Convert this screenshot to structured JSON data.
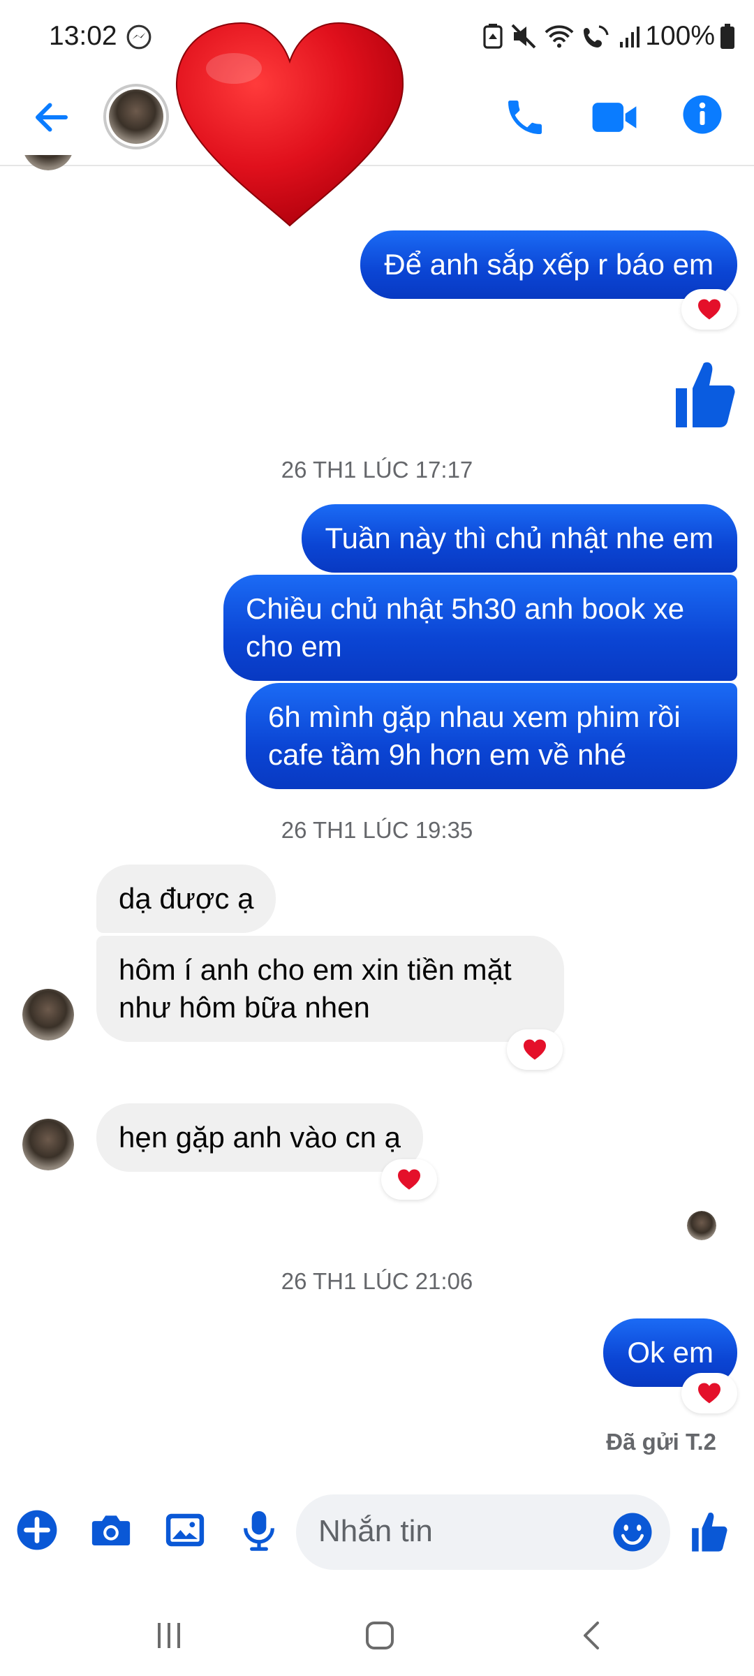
{
  "status_bar": {
    "time": "13:02",
    "battery": "100%"
  },
  "header": {
    "icons": [
      "back-arrow-icon",
      "phone-icon",
      "video-camera-icon",
      "info-icon"
    ],
    "accent_color": "#0a7cff"
  },
  "messages": [
    {
      "id": "m1",
      "side": "out",
      "text": "Để anh sắp xếp r báo em",
      "reaction": "heart"
    },
    {
      "id": "m2",
      "side": "out",
      "type": "thumbs-up-sticker"
    },
    {
      "id": "ts1",
      "type": "timestamp",
      "text": "26 TH1 LÚC 17:17"
    },
    {
      "id": "m3",
      "side": "out",
      "text": "Tuần này thì chủ nhật nhe em"
    },
    {
      "id": "m4",
      "side": "out",
      "text_lines": [
        "Chiều chủ nhật 5h30 anh book xe",
        "cho em"
      ]
    },
    {
      "id": "m5",
      "side": "out",
      "text_lines": [
        "6h mình gặp nhau xem phim rồi",
        "cafe tầm 9h hơn em về nhé"
      ]
    },
    {
      "id": "ts2",
      "type": "timestamp",
      "text": "26 TH1 LÚC 19:35"
    },
    {
      "id": "m6",
      "side": "in",
      "text": "dạ được ạ"
    },
    {
      "id": "m7",
      "side": "in",
      "text_lines": [
        "hôm í anh cho em xin tiền mặt",
        "như hôm bữa nhen"
      ],
      "reaction": "heart"
    },
    {
      "id": "m8",
      "side": "in",
      "text": "hẹn gặp anh vào cn ạ",
      "reaction": "heart"
    },
    {
      "id": "ts3",
      "type": "timestamp",
      "text": "26 TH1 LÚC 21:06"
    },
    {
      "id": "m9",
      "side": "out",
      "text": "Ok em",
      "reaction": "heart"
    }
  ],
  "m1": {
    "text": "Để anh sắp xếp r báo em"
  },
  "ts1": {
    "text": "26 TH1 LÚC 17:17"
  },
  "m3": {
    "text": "Tuần này thì chủ nhật nhe em"
  },
  "m4": {
    "line1": "Chiều chủ nhật 5h30 anh book xe",
    "line2": "cho em"
  },
  "m5": {
    "line1": "6h mình gặp nhau xem phim rồi",
    "line2": "cafe tầm 9h hơn em về nhé"
  },
  "ts2": {
    "text": "26 TH1 LÚC 19:35"
  },
  "m6": {
    "text": "dạ được ạ"
  },
  "m7": {
    "line1": "hôm í anh cho em xin tiền mặt",
    "line2": "như hôm bữa nhen"
  },
  "m8": {
    "text": "hẹn gặp anh vào cn ạ"
  },
  "ts3": {
    "text": "26 TH1 LÚC 21:06"
  },
  "m9": {
    "text": "Ok em"
  },
  "sent_status": "Đã gửi T.2",
  "composer": {
    "placeholder": "Nhắn tin",
    "icons": [
      "plus-icon",
      "camera-icon",
      "image-icon",
      "microphone-icon",
      "emoji-icon",
      "thumbs-up-icon"
    ]
  },
  "colors": {
    "outgoing_bubble": "#0b45d4",
    "incoming_bubble": "#f0f0f0",
    "accent": "#0a7cff",
    "heart": "#e4102a"
  }
}
